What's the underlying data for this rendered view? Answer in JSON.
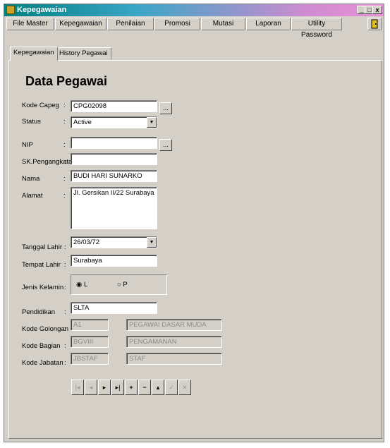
{
  "window": {
    "title": "Kepegawaian",
    "controls": [
      "_",
      "□",
      "x"
    ]
  },
  "menu": {
    "items": [
      "File Master",
      "Kepegawaian",
      "Penilaian",
      "Promosi",
      "Mutasi",
      "Laporan",
      "Utility Password"
    ]
  },
  "tabs": [
    {
      "label": "Kepegawaian"
    },
    {
      "label": "History Pegawai"
    }
  ],
  "form": {
    "heading": "Data Pegawai",
    "labels": {
      "kode_capeg": "Kode Capeg",
      "status": "Status",
      "nip": "NIP",
      "sk": "SK.Pengangkatan",
      "nama": "Nama",
      "alamat": "Alamat",
      "tanggal_lahir": "Tanggal Lahir",
      "tempat_lahir": "Tempat Lahir",
      "jenis_kelamin": "Jenis Kelamin",
      "pendidikan": "Pendidikan",
      "kode_golongan": "Kode Golongan",
      "kode_bagian": "Kode Bagian",
      "kode_jabatan": "Kode Jabatan"
    },
    "values": {
      "kode_capeg": "CPG02098",
      "status": "Active",
      "nip": "",
      "sk": "",
      "nama": "BUDI HARI SUNARKO",
      "alamat": "Jl. Gersikan II/22 Surabaya",
      "tanggal_lahir": "26/03/72",
      "tempat_lahir": "Surabaya",
      "jenis_kelamin_l": "L",
      "jenis_kelamin_p": "P",
      "pendidikan": "SLTA",
      "kode_golongan": "A1",
      "nama_golongan": "PEGAWAI DASAR MUDA",
      "kode_bagian": "BGVIII",
      "nama_bagian": "PENGAMANAN",
      "kode_jabatan": "JBSTAF",
      "nama_jabatan": "STAF"
    },
    "selected_gender": "L",
    "ellipsis": "..."
  },
  "navigator": {
    "buttons": [
      "first",
      "prior",
      "next",
      "last",
      "insert",
      "delete",
      "edit",
      "post",
      "cancel"
    ],
    "glyphs": [
      "|◂",
      "◂",
      "▸",
      "▸|",
      "+",
      "−",
      "▴",
      "✓",
      "✕"
    ],
    "enabled": [
      false,
      false,
      true,
      true,
      true,
      true,
      true,
      false,
      false
    ]
  }
}
